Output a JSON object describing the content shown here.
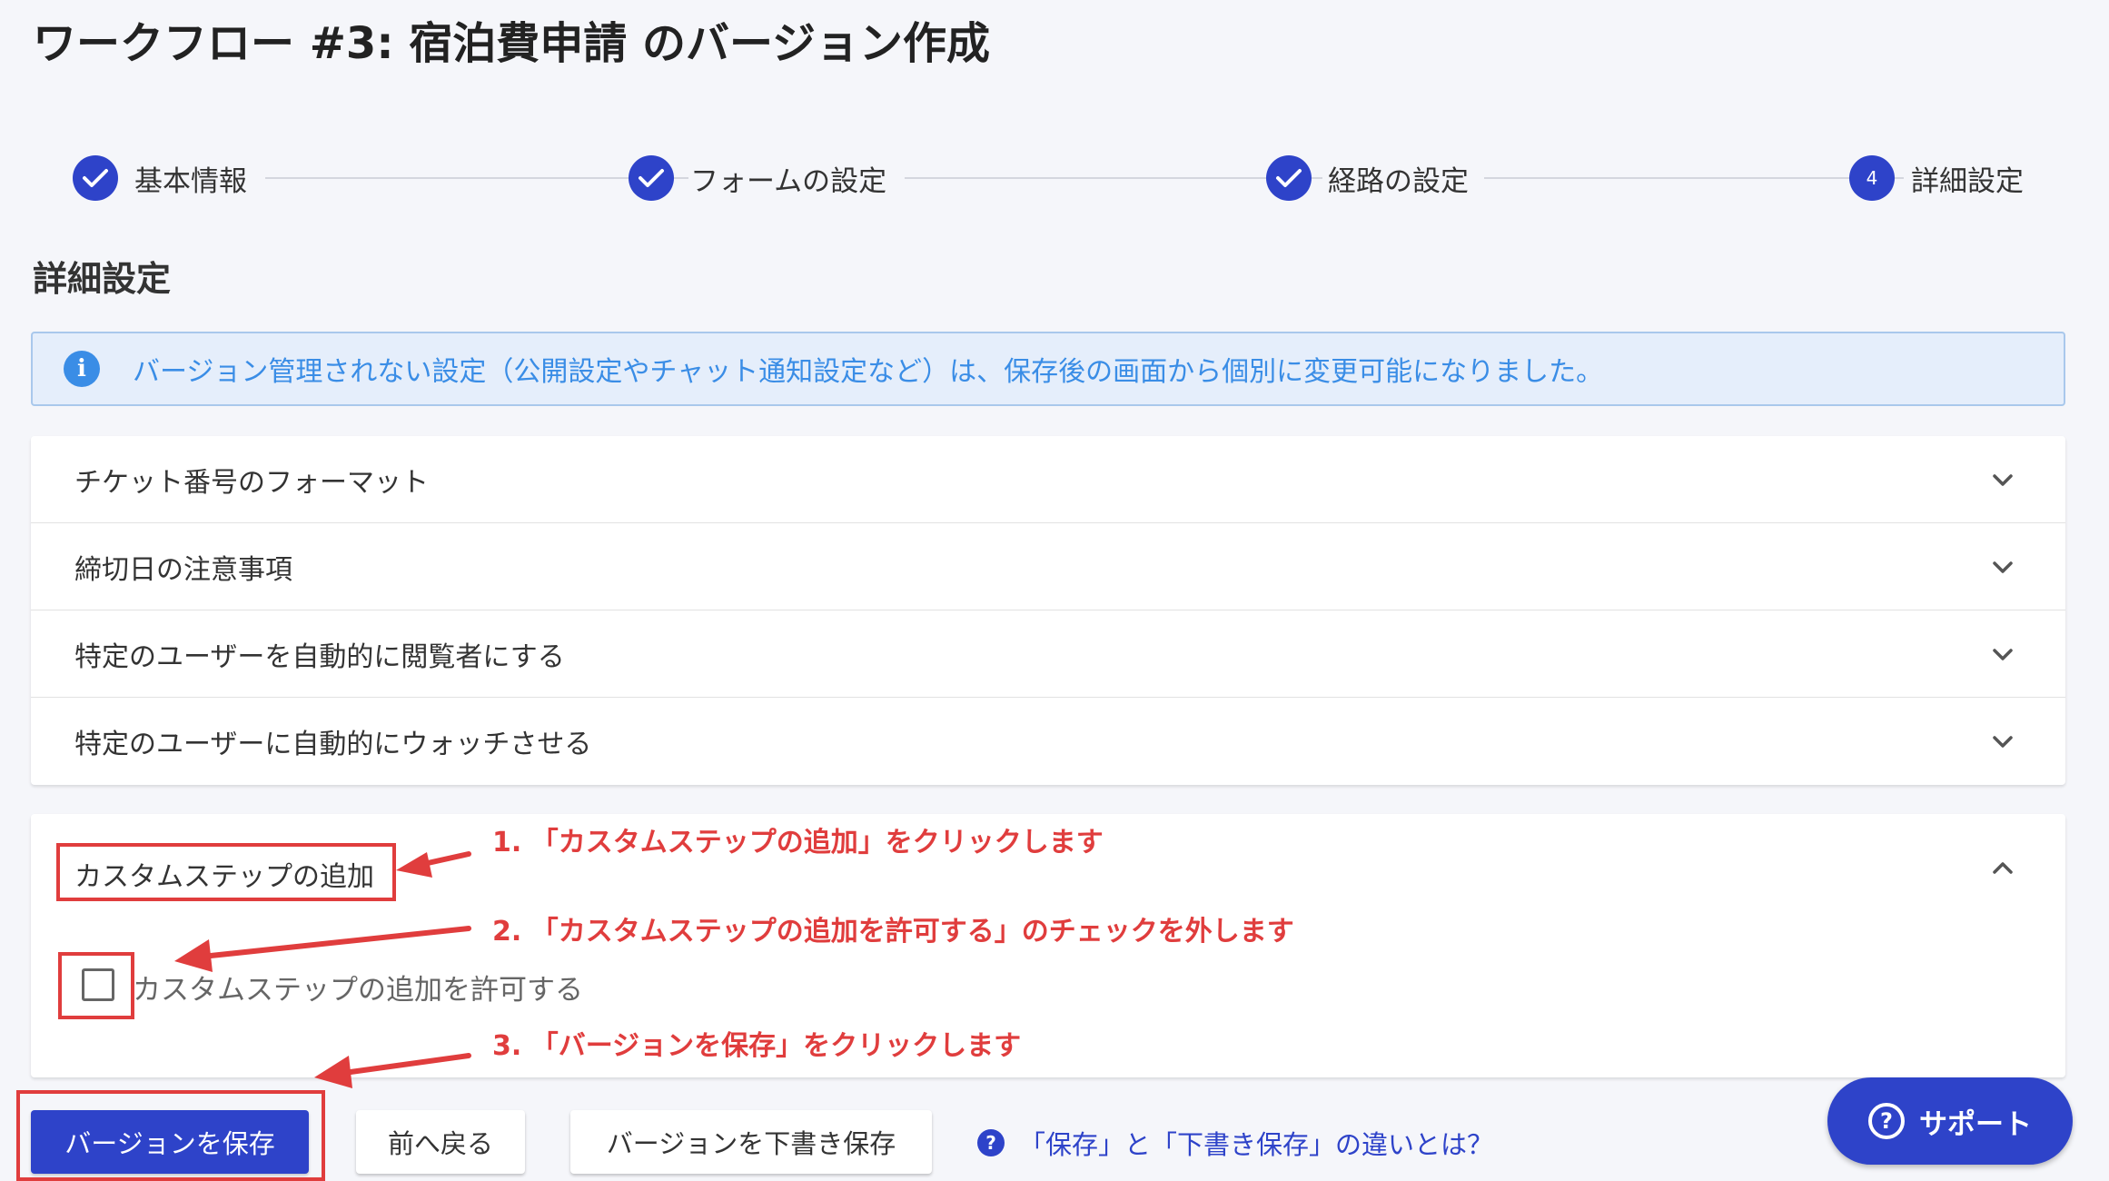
{
  "page": {
    "title": "ワークフロー #3: 宿泊費申請 のバージョン作成"
  },
  "stepper": {
    "steps": [
      {
        "label": "基本情報",
        "status": "completed",
        "icon": "check-icon"
      },
      {
        "label": "フォームの設定",
        "status": "completed",
        "icon": "check-icon"
      },
      {
        "label": "経路の設定",
        "status": "completed",
        "icon": "check-icon"
      },
      {
        "label": "詳細設定",
        "status": "current",
        "number": "4"
      }
    ]
  },
  "section": {
    "title": "詳細設定"
  },
  "alert": {
    "icon": "info-icon",
    "text": "バージョン管理されない設定（公開設定やチャット通知設定など）は、保存後の画面から個別に変更可能になりました。"
  },
  "accordion": {
    "items": [
      {
        "label": "チケット番号のフォーマット",
        "expanded": false
      },
      {
        "label": "締切日の注意事項",
        "expanded": false
      },
      {
        "label": "特定のユーザーを自動的に閲覧者にする",
        "expanded": false
      },
      {
        "label": "特定のユーザーに自動的にウォッチさせる",
        "expanded": false
      }
    ],
    "custom_step": {
      "label": "カスタムステップの追加",
      "expanded": true,
      "checkbox_label": "カスタムステップの追加を許可する",
      "checked": false
    }
  },
  "actions": {
    "save_label": "バージョンを保存",
    "back_label": "前へ戻る",
    "draft_label": "バージョンを下書き保存",
    "help_icon": "?",
    "help_text": "「保存」と「下書き保存」の違いとは？"
  },
  "support": {
    "icon": "?",
    "label": "サポート"
  },
  "annotations": {
    "step1": "1. 「カスタムステップの追加」をクリックします",
    "step2": "2. 「カスタムステップの追加を許可する」のチェックを外します",
    "step3": "3. 「バージョンを保存」をクリックします"
  },
  "colors": {
    "primary": "#2e43c9",
    "info": "#3a8de6",
    "annotation": "#e03d3d",
    "background": "#f5f6fa"
  }
}
